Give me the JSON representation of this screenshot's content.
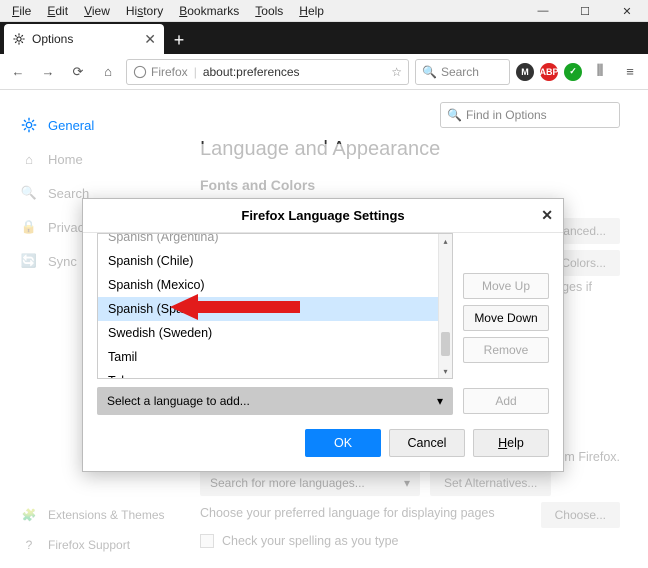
{
  "menubar": {
    "file": "File",
    "edit": "Edit",
    "view": "View",
    "history": "History",
    "bookmarks": "Bookmarks",
    "tools": "Tools",
    "help": "Help"
  },
  "tab": {
    "title": "Options"
  },
  "toolbar": {
    "brand": "Firefox",
    "url": "about:preferences",
    "search_placeholder": "Search",
    "badges": {
      "m": "M",
      "abp": "ABP"
    }
  },
  "sidebar": {
    "general": "General",
    "home": "Home",
    "search": "Search",
    "privacy": "Privacy",
    "sync": "Sync",
    "ext": "Extensions & Themes",
    "support": "Firefox Support"
  },
  "main": {
    "find_placeholder": "Find in Options",
    "h2": "Language and Appearance",
    "h3": "Fonts and Colors",
    "advanced": "Advanced...",
    "colors": "Colors...",
    "ages_if": "ages if",
    "from_ff": "s from Firefox.",
    "search_langs": "Search for more languages...",
    "set_alt": "Set Alternatives...",
    "choose_pref": "Choose your preferred language for displaying pages",
    "choose": "Choose...",
    "spellcheck": "Check your spelling as you type"
  },
  "dialog": {
    "title": "Firefox Language Settings",
    "items": [
      "Spanish (Argentina)",
      "Spanish (Chile)",
      "Spanish (Mexico)",
      "Spanish (Spain)",
      "Swedish (Sweden)",
      "Tamil",
      "Telugu"
    ],
    "selected_index": 3,
    "move_up": "Move Up",
    "move_down": "Move Down",
    "remove": "Remove",
    "add_placeholder": "Select a language to add...",
    "add": "Add",
    "ok": "OK",
    "cancel": "Cancel",
    "help": "Help"
  }
}
